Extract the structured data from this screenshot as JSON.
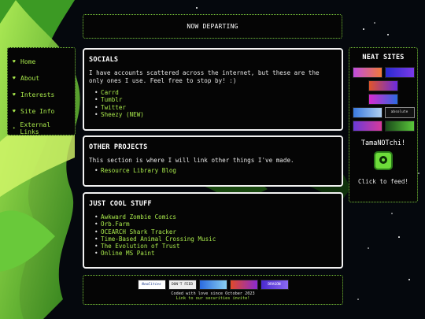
{
  "header": {
    "title": "NOW DEPARTING"
  },
  "nav": {
    "items": [
      {
        "label": "Home",
        "icon": "heart-icon"
      },
      {
        "label": "About",
        "icon": "heart-icon"
      },
      {
        "label": "Interests",
        "icon": "heart-icon"
      },
      {
        "label": "Site Info",
        "icon": "heart-icon"
      },
      {
        "label": "External Links",
        "icon": "sparkle-icon"
      }
    ]
  },
  "socials": {
    "title": "SOCIALS",
    "intro": "I have accounts scattered across the internet, but these are the only ones I use. Feel free to stop by! :)",
    "links": [
      "Carrd",
      "Tumblr",
      "Twitter",
      "Sheezy (NEW)"
    ]
  },
  "projects": {
    "title": "OTHER PROJECTS",
    "intro": "This section is where I will link other things I've made.",
    "links": [
      "Resource Library Blog"
    ]
  },
  "cool": {
    "title": "JUST COOL STUFF",
    "links": [
      "Awkward Zombie Comics",
      "Orb.Farm",
      "OCEARCH Shark Tracker",
      "Time-Based Animal Crossing Music",
      "The Evolution of Trust",
      "Online MS Paint"
    ]
  },
  "neat": {
    "title": "NEAT SITES",
    "buttons": [
      "",
      "",
      "",
      "",
      "",
      "absolute",
      "",
      ""
    ],
    "tama_title": "TamaNOTchi!",
    "tama_cta": "Click to feed!"
  },
  "footer": {
    "buttons": [
      "NeoCities",
      "DON'T FEED THE AI",
      "",
      "",
      "DRAGON"
    ],
    "note": "Coded with love since October 2023",
    "link": "Link to our securities invite!"
  },
  "colors": {
    "accent": "#a8e84b",
    "panel_bg": "#050505",
    "page_bg": "#05080d"
  }
}
